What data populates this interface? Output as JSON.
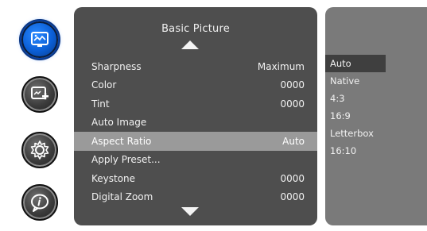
{
  "menu": {
    "title": "Basic Picture",
    "rows": [
      {
        "label": "Sharpness",
        "value": "Maximum",
        "selected": false
      },
      {
        "label": "Color",
        "value": "0000",
        "selected": false
      },
      {
        "label": "Tint",
        "value": "0000",
        "selected": false
      },
      {
        "label": "Auto Image",
        "value": "",
        "selected": false
      },
      {
        "label": "Aspect Ratio",
        "value": "Auto",
        "selected": true
      },
      {
        "label": "Apply Preset...",
        "value": "",
        "selected": false
      },
      {
        "label": "Keystone",
        "value": "0000",
        "selected": false
      },
      {
        "label": "Digital Zoom",
        "value": "0000",
        "selected": false
      }
    ]
  },
  "options": {
    "items": [
      {
        "label": "Auto",
        "selected": true
      },
      {
        "label": "Native",
        "selected": false
      },
      {
        "label": "4:3",
        "selected": false
      },
      {
        "label": "16:9",
        "selected": false
      },
      {
        "label": "Letterbox",
        "selected": false
      },
      {
        "label": "16:10",
        "selected": false
      }
    ]
  },
  "rail": {
    "icons": [
      {
        "name": "basic-picture-icon",
        "active": true
      },
      {
        "name": "advanced-picture-icon",
        "active": false
      },
      {
        "name": "settings-icon",
        "active": false
      },
      {
        "name": "info-icon",
        "active": false
      }
    ]
  },
  "colors": {
    "menu_bg": "#4e4e4e",
    "options_bg": "#7a7a7a",
    "selected_row": "#9a9a9a",
    "selected_option": "#3f3f3f",
    "active_icon": "#0b5fd6"
  }
}
